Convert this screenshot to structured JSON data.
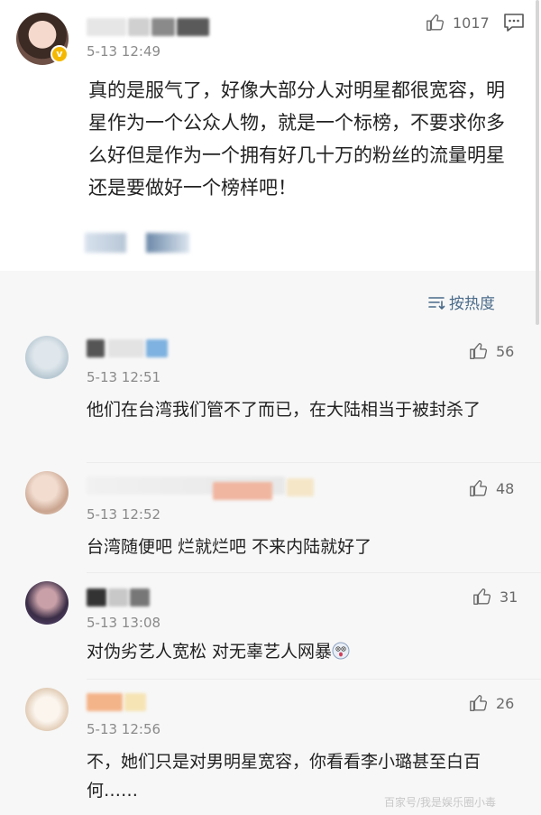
{
  "post": {
    "time": "5-13 12:49",
    "like_count": "1017",
    "text": "真的是服气了，好像大部分人对明星都很宽容，明星作为一个公众人物，就是一个标榜，不要求你多么好但是作为一个拥有好几十万的粉丝的流量明星还是要做好一个榜样吧！",
    "verified_badge": "v"
  },
  "sort": {
    "label": "按热度",
    "icon": "sort-icon"
  },
  "comments": [
    {
      "time": "5-13 12:51",
      "like_count": "56",
      "text": "他们在台湾我们管不了而已，在大陆相当于被封杀了"
    },
    {
      "time": "5-13 12:52",
      "like_count": "48",
      "text": "台湾随便吧 烂就烂吧 不来内陆就好了"
    },
    {
      "time": "5-13 13:08",
      "like_count": "31",
      "text": "对伪劣艺人宽松 对无辜艺人网暴"
    },
    {
      "time": "5-13 12:56",
      "like_count": "26",
      "text": "不，她们只是对男明星宽容，你看看李小璐甚至白百何……"
    }
  ],
  "watermark": "百家号/我是娱乐圈小毒",
  "icons": {
    "like": "thumbs-up-icon",
    "message": "message-icon",
    "emoji": "scared-emoji-icon"
  },
  "colors": {
    "accent": "#4a6b8a",
    "verified": "#f5b800",
    "time": "#8a8a8a"
  }
}
